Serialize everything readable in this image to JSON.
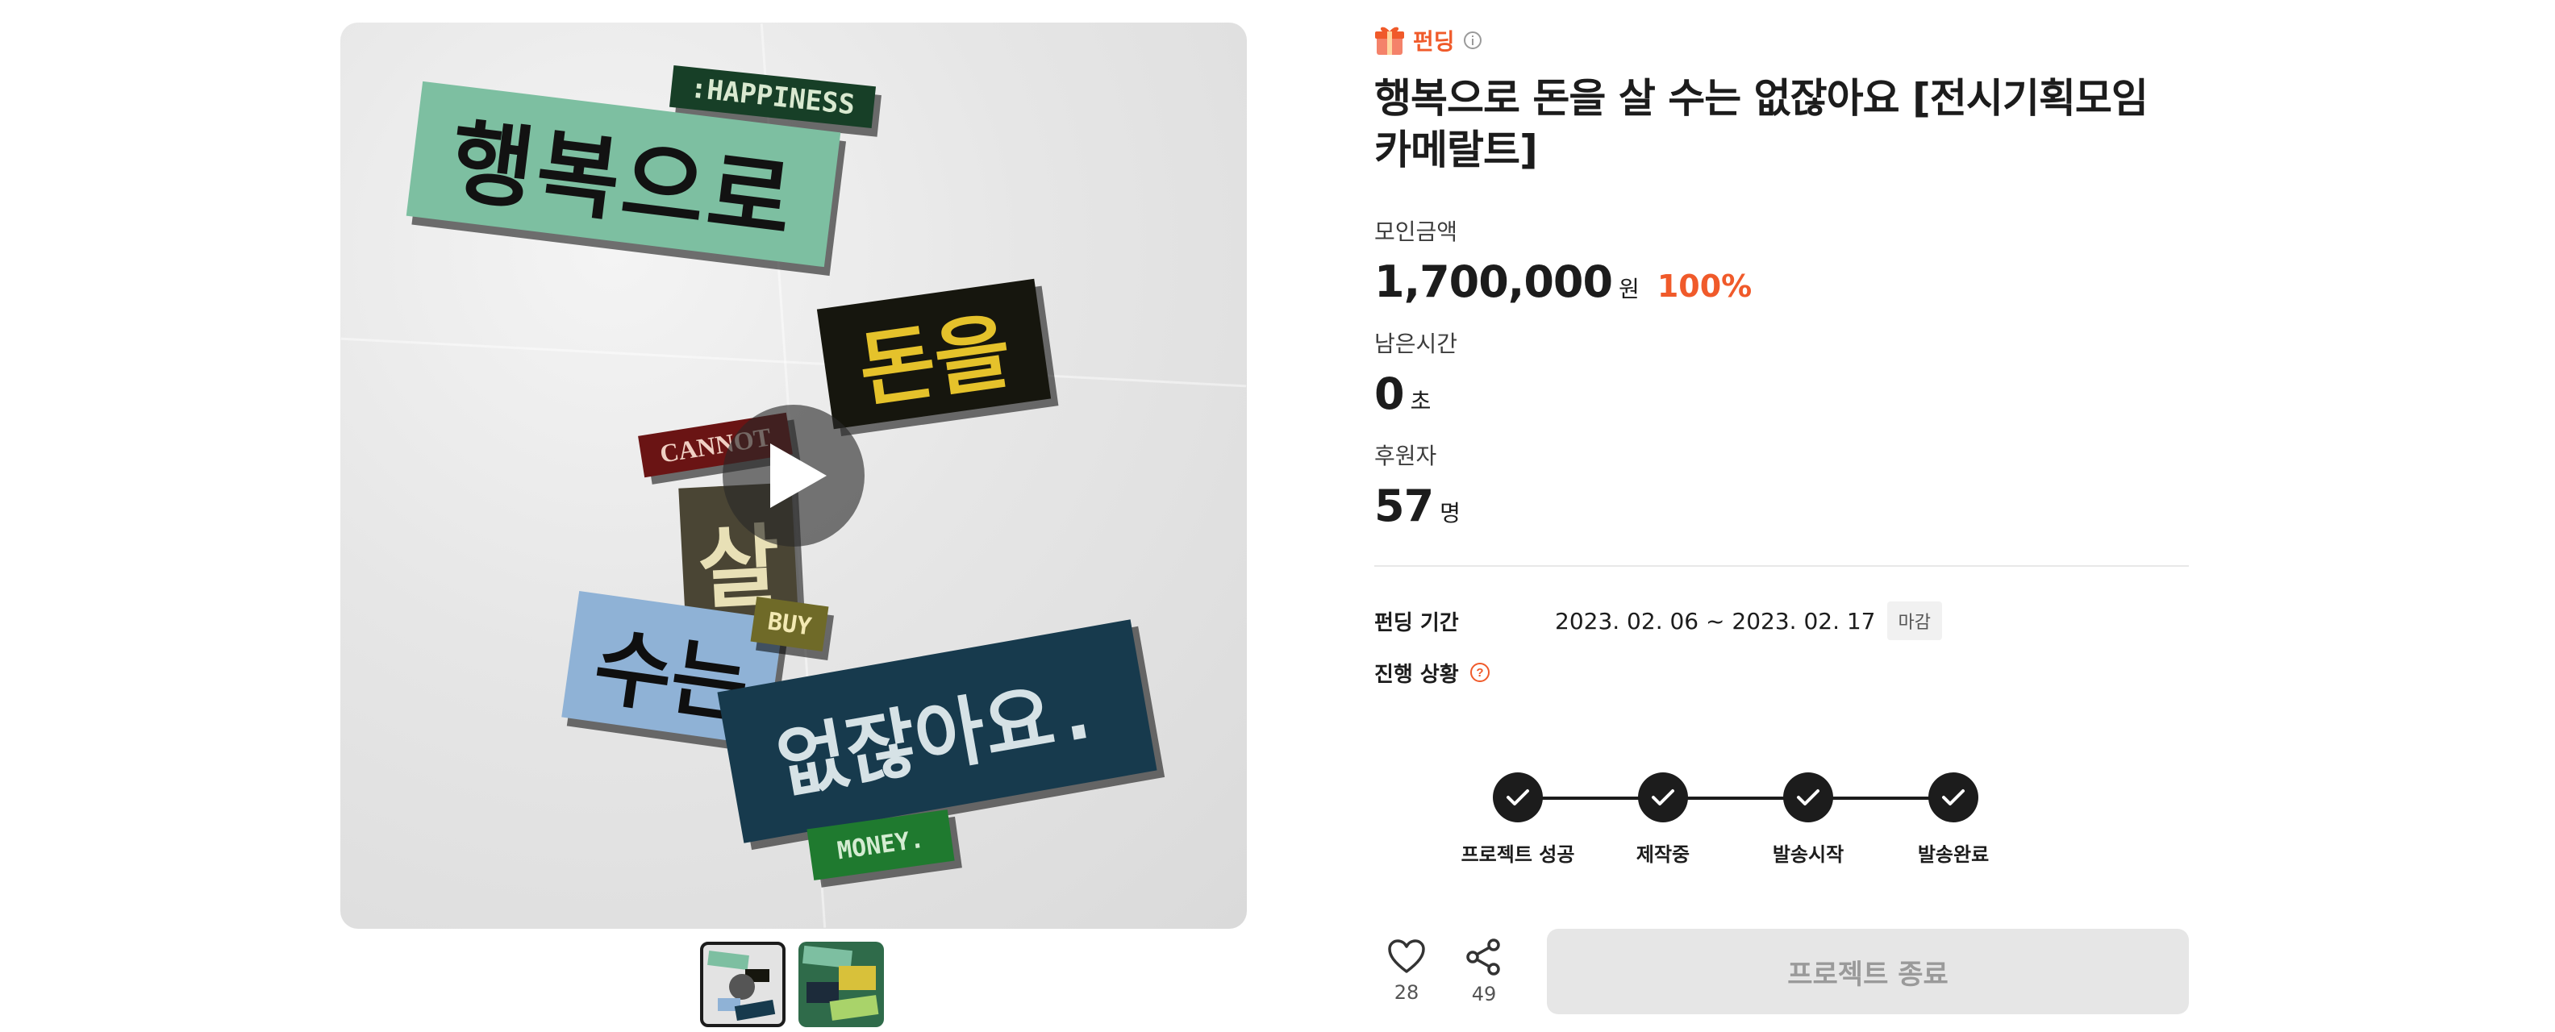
{
  "media": {
    "stickers": {
      "happiness": ":HAPPINESS",
      "hangbok": "행복으로",
      "don": "돈을",
      "cannot": "CANNOT",
      "sal": "살",
      "buy": "BUY",
      "suneun": "수는",
      "eop": "없잖아요.",
      "money": "MONEY."
    },
    "play_icon": "play-icon",
    "thumbnails": [
      {
        "name": "thumbnail-1",
        "active": true
      },
      {
        "name": "thumbnail-2",
        "active": false
      }
    ]
  },
  "project": {
    "category_icon": "gift-icon",
    "category": "펀딩",
    "title": "행복으로 돈을 살 수는 없잖아요 [전시기획모임 카메랄트]"
  },
  "stats": {
    "amount": {
      "label": "모인금액",
      "value": "1,700,000",
      "unit": "원",
      "rate": "100%"
    },
    "time_left": {
      "label": "남은시간",
      "value": "0",
      "unit": "초"
    },
    "supporters": {
      "label": "후원자",
      "value": "57",
      "unit": "명"
    }
  },
  "details": {
    "period_label": "펀딩 기간",
    "period_value": "2023. 02. 06 ~ 2023. 02. 17",
    "period_badge": "마감",
    "status_label": "진행 상황"
  },
  "progress_steps": [
    {
      "label": "프로젝트 성공",
      "done": true
    },
    {
      "label": "제작중",
      "done": true
    },
    {
      "label": "발송시작",
      "done": true
    },
    {
      "label": "발송완료",
      "done": true
    }
  ],
  "actions": {
    "like_count": "28",
    "share_count": "49",
    "end_button": "프로젝트 종료"
  },
  "colors": {
    "accent": "#f05a2a",
    "text": "#1c1c1c",
    "button_disabled_bg": "#e6e6e6",
    "button_disabled_text": "#9a9a9a"
  }
}
